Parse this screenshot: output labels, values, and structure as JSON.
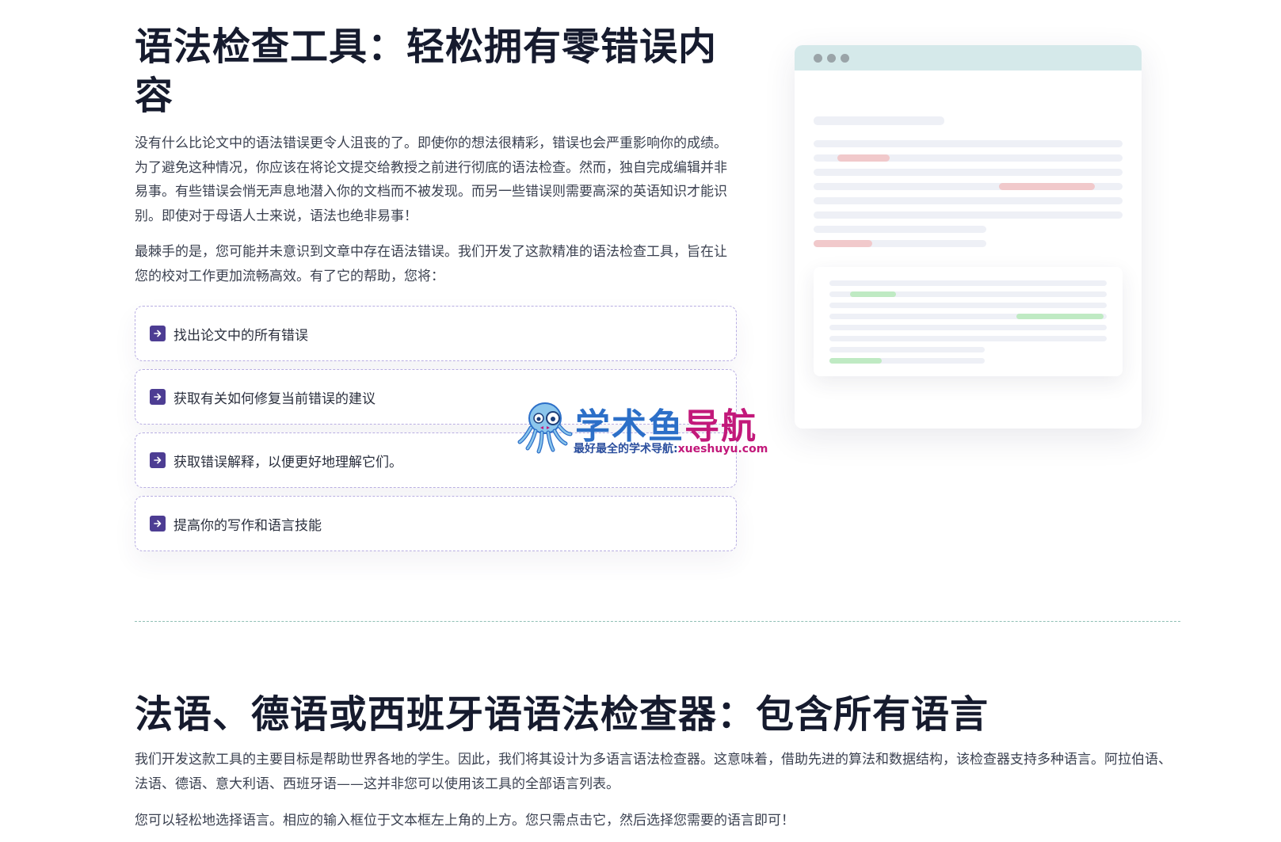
{
  "grammar_section": {
    "title": "语法检查工具：轻松拥有零错误内容",
    "paragraphs": [
      "没有什么比论文中的语法错误更令人沮丧的了。即使你的想法很精彩，错误也会严重影响你的成绩。为了避免这种情况，你应该在将论文提交给教授之前进行彻底的语法检查。然而，独自完成编辑并非易事。有些错误会悄无声息地潜入你的文档而不被发现。而另一些错误则需要高深的英语知识才能识别。即使对于母语人士来说，语法也绝非易事！",
      "最棘手的是，您可能并未意识到文章中存在语法错误。我们开发了这款精准的语法检查工具，旨在让您的校对工作更加流畅高效。有了它的帮助，您将："
    ],
    "features": [
      {
        "icon": "arrow-right-icon",
        "label": "找出论文中的所有错误"
      },
      {
        "icon": "arrow-right-icon",
        "label": "获取有关如何修复当前错误的建议"
      },
      {
        "icon": "arrow-right-icon",
        "label": "获取错误解释，以便更好地理解它们。"
      },
      {
        "icon": "arrow-right-icon",
        "label": "提高你的写作和语言技能"
      }
    ]
  },
  "watermark": {
    "title_part1": "学术鱼",
    "title_part2": "导航",
    "subtitle": "最好最全的学术导航:",
    "domain": "xueshuyu.com"
  },
  "language_section": {
    "title": "法语、德语或西班牙语语法检查器：包含所有语言",
    "paragraphs": [
      "我们开发这款工具的主要目标是帮助世界各地的学生。因此，我们将其设计为多语言语法检查器。这意味着，借助先进的算法和数据结构，该检查器支持多种语言。阿拉伯语、法语、德语、意大利语、西班牙语——这并非您可以使用该工具的全部语言列表。",
      "您可以轻松地选择语言。相应的输入框位于文本框左上角的上方。您只需点击它，然后选择您需要的语言即可！"
    ]
  },
  "colors": {
    "accent": "#4d3d93",
    "feature_border": "#b8aee2",
    "illustration_header": "#d5e9ea",
    "error_highlight": "#f1c9cb",
    "fix_highlight": "#bfeac3"
  }
}
